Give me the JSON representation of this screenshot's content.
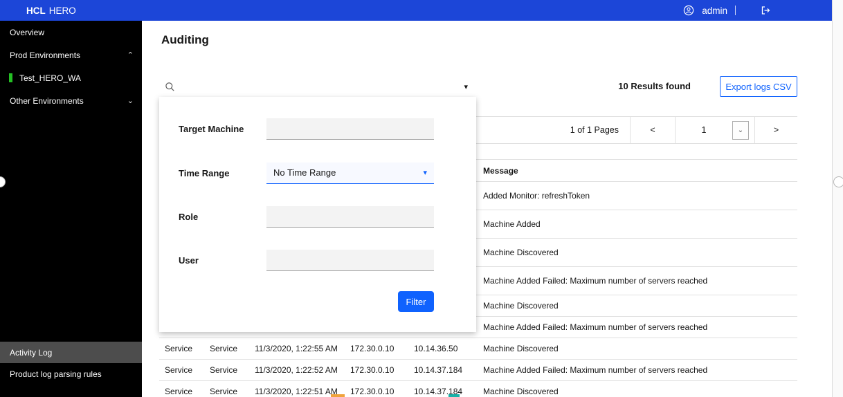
{
  "topbar": {
    "brand_primary": "HCL",
    "brand_secondary": "HERO",
    "username": "admin"
  },
  "sidebar": {
    "items": [
      {
        "label": "Overview"
      },
      {
        "label": "Prod Environments",
        "chevron": "⌃"
      },
      {
        "label": "Test_HERO_WA"
      },
      {
        "label": "Other Environments",
        "chevron": "⌄"
      }
    ],
    "footer_items": [
      {
        "label": "Activity Log"
      },
      {
        "label": "Product log parsing rules"
      }
    ]
  },
  "page": {
    "title": "Auditing"
  },
  "toolbar": {
    "results_text": "10 Results found",
    "export_button": "Export logs CSV"
  },
  "pagination": {
    "pages_label": "1 of 1 Pages",
    "prev_label": "<",
    "page_value": "1",
    "next_label": ">"
  },
  "filter": {
    "search_value": "",
    "fields": [
      {
        "label": "Target Machine",
        "value": ""
      },
      {
        "label": "Time Range",
        "value": "No Time Range"
      },
      {
        "label": "Role",
        "value": ""
      },
      {
        "label": "User",
        "value": ""
      }
    ],
    "submit_label": "Filter"
  },
  "table": {
    "message_header": "Message",
    "rows": [
      {
        "cells": [
          "",
          "",
          "",
          "",
          "",
          "Added Monitor: refreshToken"
        ]
      },
      {
        "cells": [
          "",
          "",
          "",
          "",
          "",
          "Machine Added"
        ]
      },
      {
        "cells": [
          "",
          "",
          "",
          "",
          "",
          "Machine Discovered"
        ]
      },
      {
        "cells": [
          "",
          "",
          "",
          "",
          "",
          "Machine Added Failed: Maximum number of servers reached"
        ]
      },
      {
        "cells": [
          "",
          "",
          "",
          "",
          "",
          "Machine Discovered"
        ]
      },
      {
        "cells": [
          "",
          "",
          "",
          "",
          "",
          "Machine Added Failed: Maximum number of servers reached"
        ]
      },
      {
        "cells": [
          "Service",
          "Service",
          "11/3/2020, 1:22:55 AM",
          "172.30.0.10",
          "10.14.36.50",
          "Machine Discovered"
        ]
      },
      {
        "cells": [
          "Service",
          "Service",
          "11/3/2020, 1:22:52 AM",
          "172.30.0.10",
          "10.14.37.184",
          "Machine Added Failed: Maximum number of servers reached"
        ]
      },
      {
        "cells": [
          "Service",
          "Service",
          "11/3/2020, 1:22:51 AM",
          "172.30.0.10",
          "10.14.37.184",
          "Machine Discovered"
        ]
      }
    ]
  },
  "colors": {
    "accent": "#0f62fe",
    "topbar": "#1c46d8",
    "status_green": "#24c024",
    "mark_orange": "#f0a33c",
    "mark_teal": "#18b2a8"
  }
}
